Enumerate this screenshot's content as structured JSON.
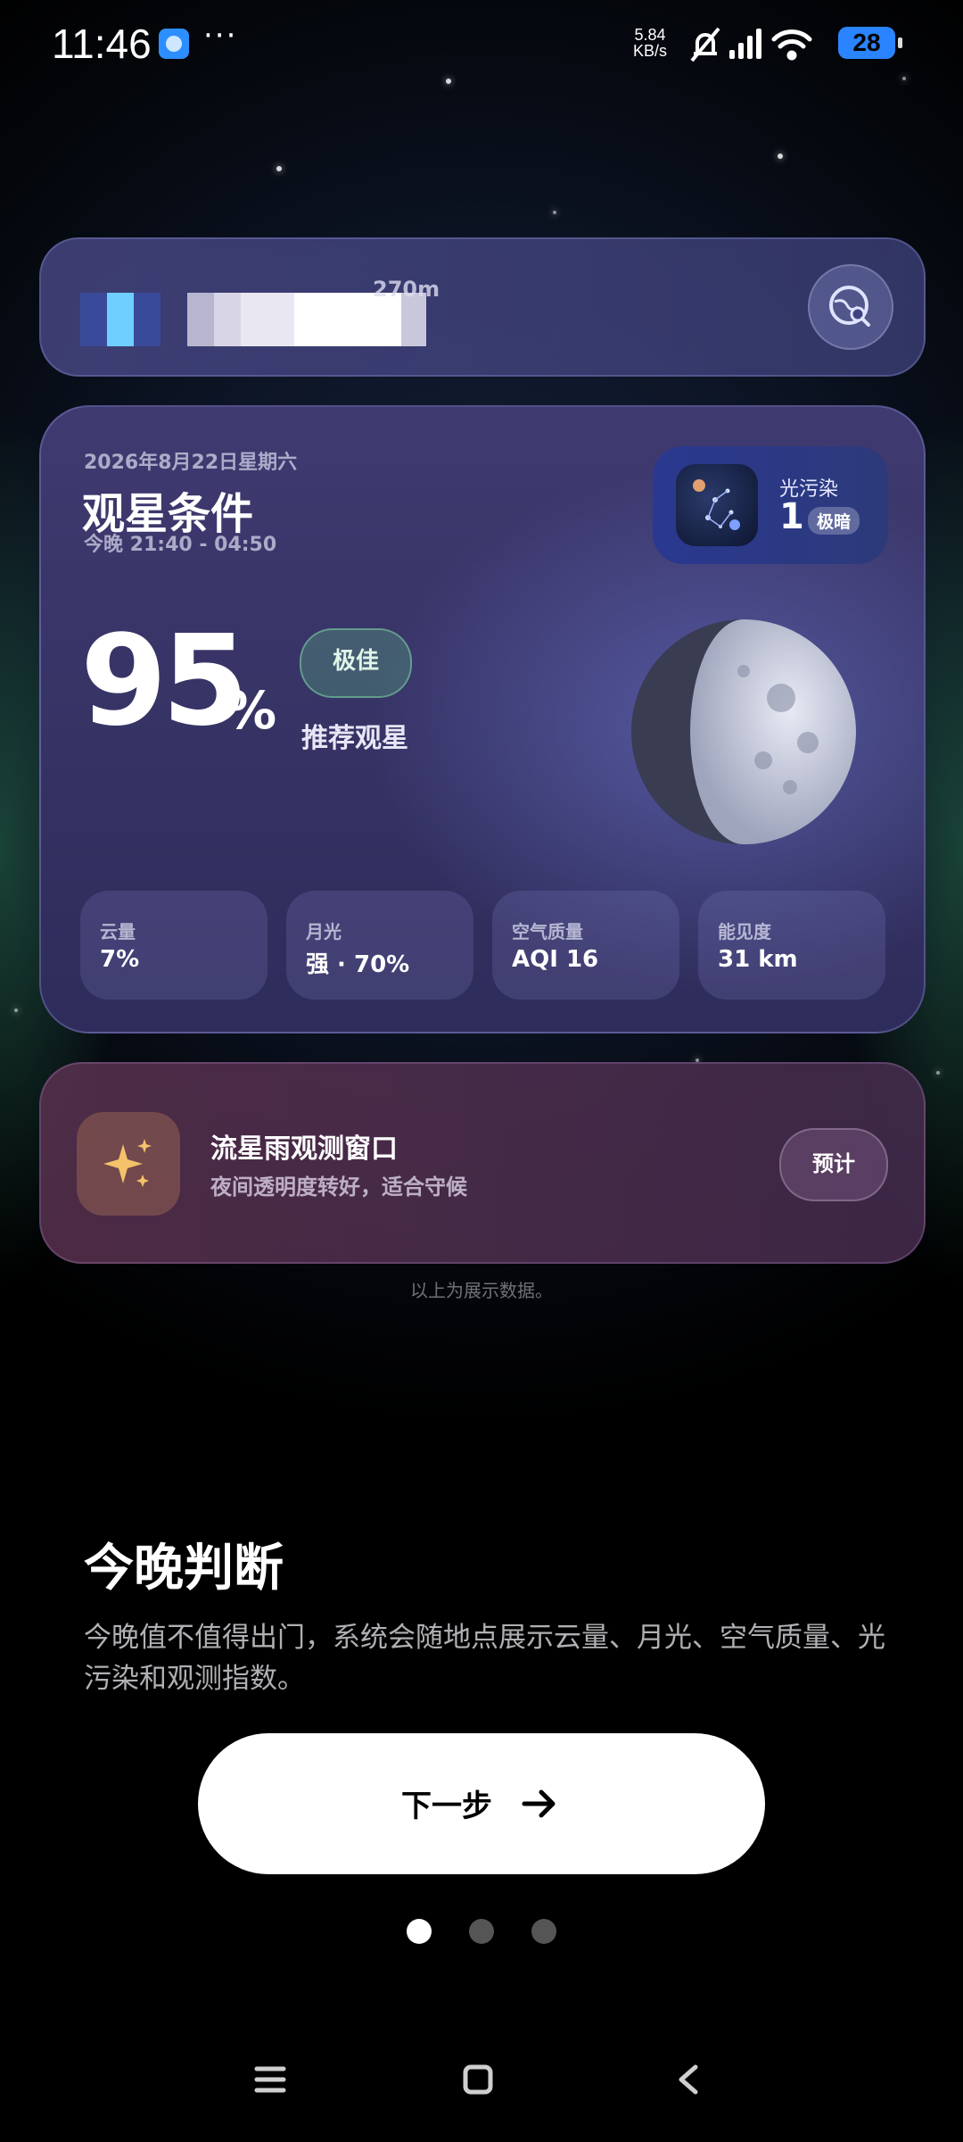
{
  "status_bar": {
    "time": "11:46",
    "more": "···",
    "net_speed_value": "5.84",
    "net_speed_unit": "KB/s",
    "battery": "28"
  },
  "location": {
    "distance": "270m"
  },
  "card": {
    "date": "2026年8月22日星期六",
    "title": "观星条件",
    "subtitle": "今晚 21:40 - 04:50",
    "light_pollution": {
      "label": "光污染",
      "value": "1",
      "badge": "极暗"
    },
    "score": "95",
    "score_unit": "%",
    "grade": "极佳",
    "recommendation": "推荐观星",
    "stats": [
      {
        "label": "云量",
        "value": "7%"
      },
      {
        "label": "月光",
        "value": "强 · 70%"
      },
      {
        "label": "空气质量",
        "value": "AQI 16"
      },
      {
        "label": "能见度",
        "value": "31 km"
      }
    ]
  },
  "meteor": {
    "title": "流星雨观测窗口",
    "subtitle": "夜间透明度转好，适合守候",
    "button": "预计"
  },
  "demo_note": "以上为展示数据。",
  "onboarding": {
    "heading": "今晚判断",
    "description": "今晚值不值得出门，系统会随地点展示云量、月光、空气质量、光污染和观测指数。",
    "next_button": "下一步",
    "page_count": 3,
    "current_page": 1
  },
  "colors": {
    "accent_green": "#5aa882",
    "card_purple": "#3f3a70",
    "battery_blue": "#2a84ff"
  }
}
